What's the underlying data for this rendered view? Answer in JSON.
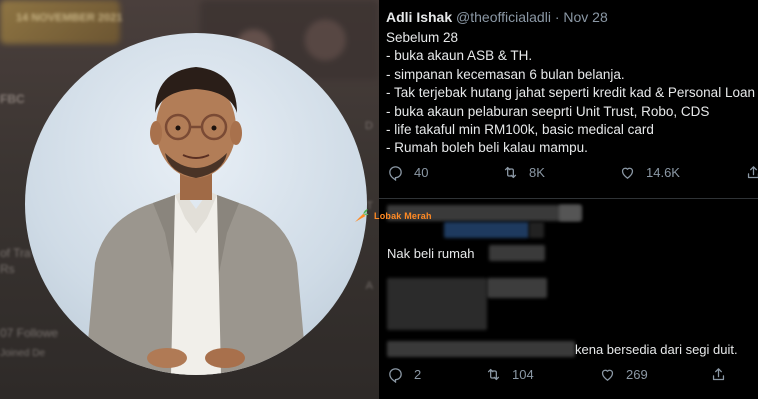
{
  "left": {
    "bg_banner": "14 NOVEMBER 2021",
    "bg_texts": [
      "FBC",
      "of Tra",
      "Rs",
      "07 Followe",
      "Joined De"
    ],
    "bg_right_texts": [
      "D",
      "T",
      "A"
    ]
  },
  "tweet": {
    "author_name": "Adli Ishak",
    "author_handle": "@theofficialadli",
    "separator": "·",
    "date": "Nov 28",
    "lines": [
      "Sebelum 28",
      "- buka akaun ASB & TH.",
      "- simpanan kecemasan 6 bulan belanja.",
      "- Tak terjebak hutang jahat seperti kredit kad & Personal Loan",
      "- buka akaun pelaburan seeprti Unit Trust, Robo, CDS",
      "- life takaful min RM100k, basic medical card",
      "- Rumah boleh beli kalau mampu."
    ],
    "actions": {
      "replies": "40",
      "retweets": "8K",
      "likes": "14.6K"
    }
  },
  "replies": {
    "reply1_text": "Nak beli rumah",
    "reply3_text": "kena bersedia dari segi duit.",
    "actions": {
      "replies": "2",
      "retweets": "104",
      "likes": "269"
    }
  },
  "watermark": {
    "label": "Lobak Merah",
    "color": "#ff8a24"
  },
  "colors": {
    "tweet_text": "#e7e9ea",
    "muted": "#8b98a5",
    "divider": "#2f3336"
  },
  "icons": [
    "reply-icon",
    "retweet-icon",
    "like-icon",
    "share-icon",
    "carrot-logo-icon"
  ]
}
